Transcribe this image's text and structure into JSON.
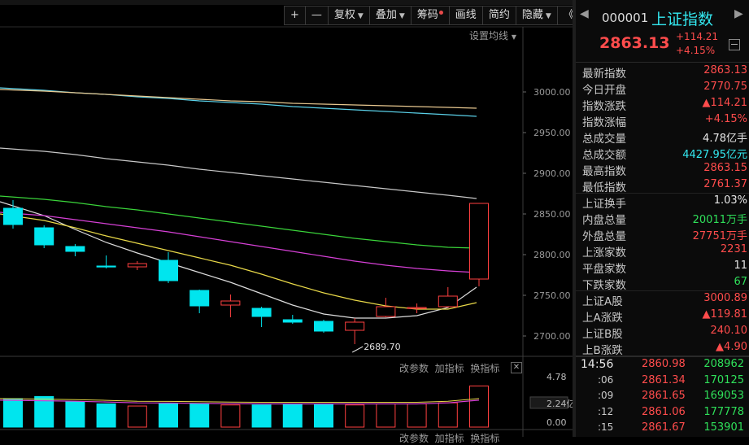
{
  "top_menu": [
    "",
    "",
    "",
    "",
    "",
    "",
    "",
    "",
    "",
    ""
  ],
  "toolbar": {
    "zoom_in": "+",
    "zoom_out": "—",
    "fuquan": "复权",
    "diejia": "叠加",
    "chouma": "筹码",
    "huaxian": "画线",
    "jianyue": "简约",
    "yincang": "隐藏",
    "collapse": "《"
  },
  "set_ma_label": "设置均线",
  "price_axis": [
    "3000.00",
    "2950.00",
    "2900.00",
    "2850.00",
    "2800.00",
    "2750.00",
    "2700.00"
  ],
  "low_annotation": "2689.70",
  "volume_header": {
    "gai": "改参数",
    "jia": "加指标",
    "huan": "换指标",
    "close": "✕"
  },
  "volume_axis": [
    "4.78",
    "2.24亿",
    "0.00"
  ],
  "bottom_header": {
    "gai": "改参数",
    "jia": "加指标",
    "huan": "换指标",
    "close": "✕"
  },
  "chart_data": {
    "type": "candlestick",
    "candles": [
      {
        "open": 2857,
        "close": 2837,
        "high": 2867,
        "low": 2832
      },
      {
        "open": 2833,
        "close": 2812,
        "high": 2836,
        "low": 2808
      },
      {
        "open": 2810,
        "close": 2804,
        "high": 2813,
        "low": 2798
      },
      {
        "open": 2786,
        "close": 2785,
        "high": 2799,
        "low": 2783
      },
      {
        "open": 2785,
        "close": 2789,
        "high": 2792,
        "low": 2781
      },
      {
        "open": 2793,
        "close": 2768,
        "high": 2803,
        "low": 2765
      },
      {
        "open": 2756,
        "close": 2737,
        "high": 2757,
        "low": 2728
      },
      {
        "open": 2738,
        "close": 2743,
        "high": 2751,
        "low": 2723
      },
      {
        "open": 2734,
        "close": 2724,
        "high": 2736,
        "low": 2711
      },
      {
        "open": 2720,
        "close": 2717,
        "high": 2726,
        "low": 2715
      },
      {
        "open": 2718,
        "close": 2706,
        "high": 2720,
        "low": 2704
      },
      {
        "open": 2707,
        "close": 2717,
        "high": 2722,
        "low": 2690
      },
      {
        "open": 2724,
        "close": 2736,
        "high": 2747,
        "low": 2723
      },
      {
        "open": 2734,
        "close": 2735,
        "high": 2740,
        "low": 2728
      },
      {
        "open": 2736,
        "close": 2749,
        "high": 2760,
        "low": 2735
      },
      {
        "open": 2770,
        "close": 2863,
        "high": 2863,
        "low": 2761
      }
    ],
    "volume_max": 4.78,
    "volumes": [
      2.7,
      2.9,
      2.4,
      2.2,
      2.0,
      2.2,
      2.2,
      2.1,
      2.1,
      2.2,
      2.2,
      2.1,
      2.2,
      2.2,
      2.3,
      3.9
    ],
    "moving_averages": [
      {
        "color": "#dddddd",
        "values": [
          2865,
          2848,
          2831,
          2815,
          2802,
          2790,
          2778,
          2766,
          2752,
          2738,
          2727,
          2722,
          2722,
          2725,
          2735,
          2760
        ]
      },
      {
        "color": "#e8d848",
        "values": [
          2850,
          2842,
          2833,
          2823,
          2814,
          2805,
          2796,
          2787,
          2776,
          2764,
          2753,
          2744,
          2737,
          2733,
          2733,
          2741
        ]
      },
      {
        "color": "#d640d6",
        "values": [
          2852,
          2848,
          2843,
          2838,
          2833,
          2828,
          2822,
          2816,
          2810,
          2804,
          2798,
          2792,
          2787,
          2783,
          2780,
          2778
        ]
      },
      {
        "color": "#3ad43a",
        "values": [
          2872,
          2868,
          2864,
          2859,
          2855,
          2850,
          2845,
          2840,
          2835,
          2830,
          2825,
          2820,
          2816,
          2812,
          2809,
          2808
        ]
      },
      {
        "color": "#c8c8c8",
        "values": [
          2931,
          2927,
          2923,
          2918,
          2914,
          2910,
          2905,
          2901,
          2897,
          2893,
          2889,
          2885,
          2881,
          2877,
          2873,
          2869
        ]
      },
      {
        "color": "#5ad0e8",
        "values": [
          3005,
          3002,
          2999,
          2997,
          2994,
          2992,
          2989,
          2987,
          2985,
          2982,
          2980,
          2978,
          2976,
          2974,
          2972,
          2970
        ]
      },
      {
        "color": "#e8c890",
        "values": [
          3003,
          3001,
          2999,
          2997,
          2995,
          2993,
          2991,
          2989,
          2988,
          2986,
          2985,
          2984,
          2983,
          2982,
          2981,
          2980
        ]
      }
    ],
    "volume_ma": [
      2.55,
      2.5,
      2.45,
      2.38,
      2.3,
      2.28,
      2.25,
      2.22,
      2.2,
      2.2,
      2.2,
      2.2,
      2.2,
      2.2,
      2.3,
      2.55
    ],
    "colors": {
      "up": "#ff4040",
      "down": "#00e5ee"
    }
  },
  "panel": {
    "code": "000001",
    "name": "上证指数",
    "price": "2863.13",
    "change": "+114.21",
    "change_pct": "+4.15%",
    "rows": [
      {
        "label": "最新指数",
        "value": "2863.13",
        "cls": "red"
      },
      {
        "label": "今日开盘",
        "value": "2770.75",
        "cls": "red"
      },
      {
        "label": "指数涨跌",
        "value": "▲114.21",
        "cls": "red"
      },
      {
        "label": "指数涨幅",
        "value": "+4.15%",
        "cls": "red"
      },
      {
        "label": "总成交量",
        "value": "4.78亿手",
        "cls": "white"
      },
      {
        "label": "总成交额",
        "value": "4427.95亿元",
        "cls": "cyan"
      },
      {
        "label": "最高指数",
        "value": "2863.15",
        "cls": "red"
      },
      {
        "label": "最低指数",
        "value": "2761.37",
        "cls": "red"
      },
      {
        "label": "上证换手",
        "value": "1.03%",
        "cls": "white"
      },
      {
        "label": "内盘总量",
        "value": "20011万手",
        "cls": "green"
      },
      {
        "label": "外盘总量",
        "value": "27751万手",
        "cls": "red"
      },
      {
        "label": "上涨家数",
        "value": "2231",
        "cls": "red"
      },
      {
        "label": "平盘家数",
        "value": "11",
        "cls": "white"
      },
      {
        "label": "下跌家数",
        "value": "67",
        "cls": "green"
      },
      {
        "label": "上证A股",
        "value": "3000.89",
        "cls": "red"
      },
      {
        "label": "上A涨跌",
        "value": "▲119.81",
        "cls": "red"
      },
      {
        "label": "上证B股",
        "value": "240.10",
        "cls": "red"
      },
      {
        "label": "上B涨跌",
        "value": "▲4.90",
        "cls": "red"
      }
    ],
    "ticks": [
      {
        "time": "14:56",
        "price": "2860.98",
        "vol": "208962"
      },
      {
        "time": ":06",
        "price": "2861.34",
        "vol": "170125"
      },
      {
        "time": ":09",
        "price": "2861.65",
        "vol": "169053"
      },
      {
        "time": ":12",
        "price": "2861.06",
        "vol": "177778"
      },
      {
        "time": ":15",
        "price": "2861.67",
        "vol": "153901"
      }
    ]
  }
}
